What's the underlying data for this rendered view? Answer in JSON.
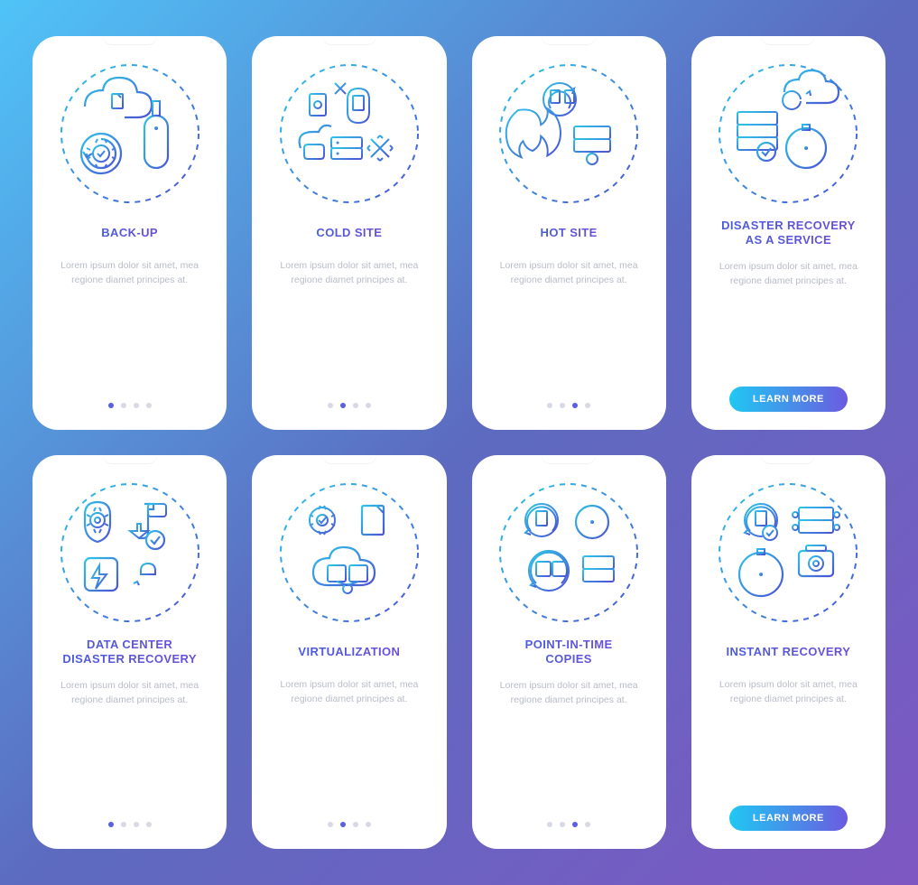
{
  "body_text": "Lorem ipsum dolor sit amet, mea regione diamet principes at.",
  "cta_label": "LEARN MORE",
  "dot_count": 4,
  "cards": [
    {
      "id": "back-up",
      "title": "BACK-UP",
      "icon": "backup-icon",
      "active_dot": 0,
      "has_cta": false
    },
    {
      "id": "cold-site",
      "title": "COLD SITE",
      "icon": "cold-site-icon",
      "active_dot": 1,
      "has_cta": false
    },
    {
      "id": "hot-site",
      "title": "HOT SITE",
      "icon": "hot-site-icon",
      "active_dot": 2,
      "has_cta": false
    },
    {
      "id": "draas",
      "title": "DISASTER RECOVERY\nAS A SERVICE",
      "icon": "draas-icon",
      "active_dot": 3,
      "has_cta": true
    },
    {
      "id": "dc-dr",
      "title": "DATA CENTER\nDISASTER RECOVERY",
      "icon": "dc-dr-icon",
      "active_dot": 0,
      "has_cta": false
    },
    {
      "id": "virtualization",
      "title": "VIRTUALIZATION",
      "icon": "virtualization-icon",
      "active_dot": 1,
      "has_cta": false
    },
    {
      "id": "pit-copies",
      "title": "POINT-IN-TIME\nCOPIES",
      "icon": "pit-copies-icon",
      "active_dot": 2,
      "has_cta": false
    },
    {
      "id": "instant-recovery",
      "title": "INSTANT RECOVERY",
      "icon": "instant-recovery-icon",
      "active_dot": 3,
      "has_cta": true
    }
  ],
  "colors": {
    "grad_start": "#2DC5E8",
    "grad_end": "#4B52D6"
  }
}
